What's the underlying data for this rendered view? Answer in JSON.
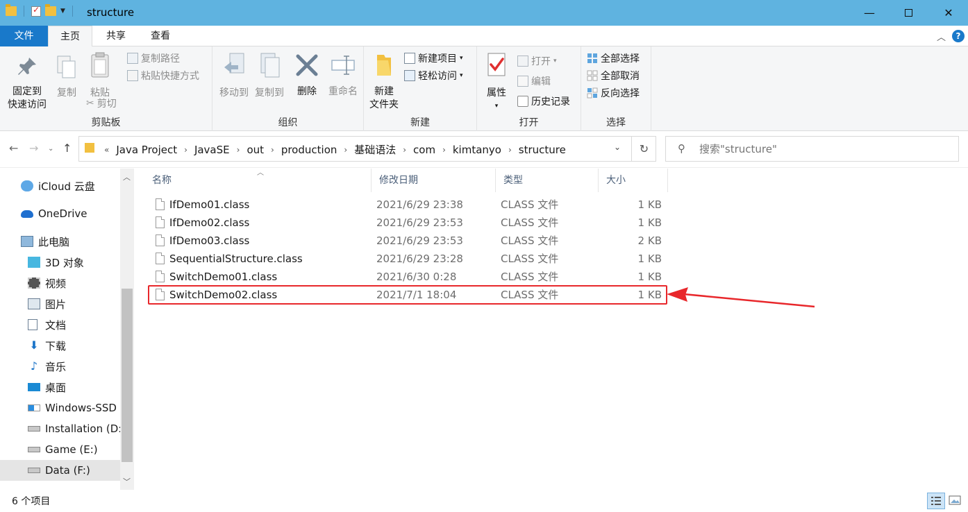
{
  "window": {
    "title": "structure"
  },
  "tabs": {
    "file": "文件",
    "home": "主页",
    "share": "共享",
    "view": "查看"
  },
  "ribbon": {
    "clipboard": {
      "label": "剪贴板",
      "pin": [
        "固定到",
        "快速访问"
      ],
      "copy": "复制",
      "paste": "粘贴",
      "copy_path": "复制路径",
      "paste_shortcut": "粘贴快捷方式",
      "cut": "剪切"
    },
    "organize": {
      "label": "组织",
      "move_to": "移动到",
      "copy_to": "复制到",
      "delete": "删除",
      "rename": "重命名"
    },
    "new": {
      "label": "新建",
      "new_folder": [
        "新建",
        "文件夹"
      ],
      "new_item": "新建项目",
      "easy_access": "轻松访问"
    },
    "open": {
      "label": "打开",
      "properties": "属性",
      "open": "打开",
      "edit": "编辑",
      "history": "历史记录"
    },
    "select": {
      "label": "选择",
      "select_all": "全部选择",
      "select_none": "全部取消",
      "invert": "反向选择"
    }
  },
  "address": {
    "prefix": "«",
    "crumbs": [
      "Java Project",
      "JavaSE",
      "out",
      "production",
      "基础语法",
      "com",
      "kimtanyo",
      "structure"
    ]
  },
  "search": {
    "placeholder": "搜索\"structure\""
  },
  "nav": {
    "items": [
      {
        "label": "iCloud 云盘",
        "icon": "icloud-icon"
      },
      {
        "label": "OneDrive",
        "icon": "onedrive-icon"
      },
      {
        "label": "此电脑",
        "icon": "computer-icon"
      },
      {
        "label": "3D 对象",
        "icon": "3d-objects-icon"
      },
      {
        "label": "视频",
        "icon": "video-icon"
      },
      {
        "label": "图片",
        "icon": "pictures-icon"
      },
      {
        "label": "文档",
        "icon": "documents-icon"
      },
      {
        "label": "下载",
        "icon": "downloads-icon"
      },
      {
        "label": "音乐",
        "icon": "music-icon"
      },
      {
        "label": "桌面",
        "icon": "desktop-icon"
      },
      {
        "label": "Windows-SSD",
        "icon": "windows-drive-icon"
      },
      {
        "label": "Installation (D:)",
        "icon": "drive-icon"
      },
      {
        "label": "Game (E:)",
        "icon": "drive-icon"
      },
      {
        "label": "Data (F:)",
        "icon": "drive-icon"
      }
    ]
  },
  "columns": {
    "name": "名称",
    "date": "修改日期",
    "type": "类型",
    "size": "大小"
  },
  "files": [
    {
      "name": "IfDemo01.class",
      "date": "2021/6/29 23:38",
      "type": "CLASS 文件",
      "size": "1 KB"
    },
    {
      "name": "IfDemo02.class",
      "date": "2021/6/29 23:53",
      "type": "CLASS 文件",
      "size": "1 KB"
    },
    {
      "name": "IfDemo03.class",
      "date": "2021/6/29 23:53",
      "type": "CLASS 文件",
      "size": "2 KB"
    },
    {
      "name": "SequentialStructure.class",
      "date": "2021/6/29 23:28",
      "type": "CLASS 文件",
      "size": "1 KB"
    },
    {
      "name": "SwitchDemo01.class",
      "date": "2021/6/30 0:28",
      "type": "CLASS 文件",
      "size": "1 KB"
    },
    {
      "name": "SwitchDemo02.class",
      "date": "2021/7/1 18:04",
      "type": "CLASS 文件",
      "size": "1 KB"
    }
  ],
  "status": {
    "count": "6 个项目"
  },
  "colors": {
    "accent": "#1979ca",
    "titlebar": "#5fb3e0",
    "annotation": "#e8272b"
  }
}
